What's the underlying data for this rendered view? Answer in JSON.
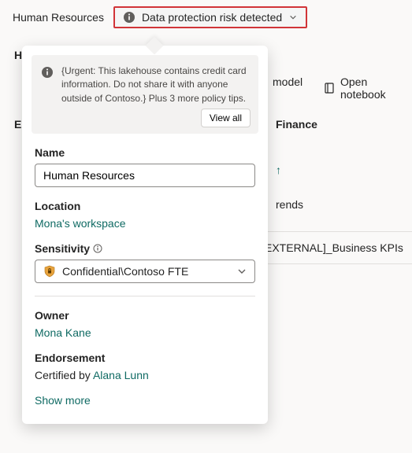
{
  "header": {
    "title": "Human Resources",
    "risk_label": "Data protection risk detected"
  },
  "toolbar": {
    "model_label": "model",
    "open_notebook_label": "Open notebook"
  },
  "sections": {
    "finance": "Finance",
    "trends": "rends",
    "kpis": "EXTERNAL]_Business KPIs"
  },
  "letters": {
    "h": "H",
    "e": "E"
  },
  "popover": {
    "policy_text": "{Urgent: This lakehouse contains credit card information. Do not share it with anyone outside of Contoso.} Plus 3 more policy tips.",
    "view_all": "View all",
    "name_label": "Name",
    "name_value": "Human Resources",
    "location_label": "Location",
    "location_value": "Mona's workspace",
    "sensitivity_label": "Sensitivity",
    "sensitivity_value": "Confidential\\Contoso FTE",
    "owner_label": "Owner",
    "owner_value": "Mona Kane",
    "endorsement_label": "Endorsement",
    "endorsement_prefix": "Certified by ",
    "endorsement_name": "Alana Lunn",
    "show_more": "Show more"
  }
}
